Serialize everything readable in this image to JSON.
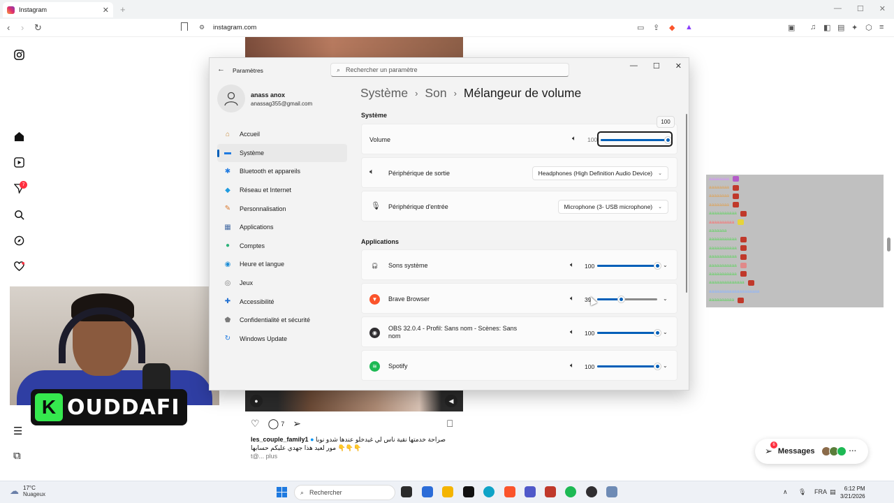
{
  "browser": {
    "tab_title": "Instagram",
    "tab_close": "✕",
    "new_tab": "+",
    "url": "instagram.com",
    "controls": {
      "minimize": "—",
      "maximize": "☐",
      "close": "✕"
    }
  },
  "instagram": {
    "nav_badge": "7",
    "post": {
      "comment_count": "7",
      "username": "les_couple_family1",
      "caption_line1": "صراحة خدمتها نقية ناس لي غيدخلو عندها شدو نوبا",
      "caption_line2": "مور لعيد هذا جهدي عليكم حسابها 👇👇👇",
      "tag": "t@...",
      "more": "plus"
    },
    "messages": {
      "label": "Messages",
      "badge": "6"
    }
  },
  "stream": {
    "badge_letter": "K",
    "badge_name": "OUDDAFI",
    "chat_rows": [
      {
        "user": "aaaaaaaa",
        "color": "#d38cff",
        "emote": "#b45cc9"
      },
      {
        "user": "aaaaaaaa",
        "color": "#e0a050",
        "emote": "#c0392b"
      },
      {
        "user": "aaaaaaaa",
        "color": "#e0a050",
        "emote": "#c0392b"
      },
      {
        "user": "aaaaaaaa",
        "color": "#e0a050",
        "emote": "#c0392b"
      },
      {
        "user": "aaaaaaaaaaa",
        "color": "#5fd35f",
        "emote": "#c0392b"
      },
      {
        "user": "aaaaaaaaaa",
        "color": "#ff6b6b",
        "emote": "#e6d43a"
      },
      {
        "user": "aaaaaaa",
        "color": "#5fd35f",
        "emote": ""
      },
      {
        "user": "aaaaaaaaaaa",
        "color": "#5fd35f",
        "emote": "#c0392b"
      },
      {
        "user": "aaaaaaaaaaa",
        "color": "#5fd35f",
        "emote": "#c0392b"
      },
      {
        "user": "aaaaaaaaaaa",
        "color": "#5fd35f",
        "emote": "#c0392b"
      },
      {
        "user": "aaaaaaaaaaa",
        "color": "#5fd35f",
        "emote": "#e08a8a"
      },
      {
        "user": "aaaaaaaaaaa",
        "color": "#5fd35f",
        "emote": "#c0392b"
      },
      {
        "user": "aaaaaaaaaaaaaa",
        "color": "#5fd35f",
        "emote": "#c0392b"
      },
      {
        "user": "aaaaaaaaaaaaaaaaaaaa",
        "color": "#8ab4ff",
        "emote": ""
      },
      {
        "user": "aaaaaaaaaa",
        "color": "#5fd35f",
        "emote": "#c0392b"
      }
    ]
  },
  "settings": {
    "title": "Paramètres",
    "search_placeholder": "Rechercher un paramètre",
    "user_name": "anass anox",
    "user_email": "anassag355@gmail.com",
    "nav": [
      {
        "label": "Accueil",
        "icon": "home-icon",
        "color": "#c98a3a"
      },
      {
        "label": "Système",
        "icon": "system-icon",
        "color": "#1f7ae0",
        "active": true
      },
      {
        "label": "Bluetooth et appareils",
        "icon": "bluetooth-icon",
        "color": "#1f7ae0"
      },
      {
        "label": "Réseau et Internet",
        "icon": "network-icon",
        "color": "#1f9be0"
      },
      {
        "label": "Personnalisation",
        "icon": "brush-icon",
        "color": "#d9772b"
      },
      {
        "label": "Applications",
        "icon": "apps-icon",
        "color": "#4a6fa5"
      },
      {
        "label": "Comptes",
        "icon": "account-icon",
        "color": "#2db37a"
      },
      {
        "label": "Heure et langue",
        "icon": "globe-icon",
        "color": "#1f8ed6"
      },
      {
        "label": "Jeux",
        "icon": "gamepad-icon",
        "color": "#777777"
      },
      {
        "label": "Accessibilité",
        "icon": "accessibility-icon",
        "color": "#1f6fd1"
      },
      {
        "label": "Confidentialité et sécurité",
        "icon": "shield-icon",
        "color": "#7a7a7a"
      },
      {
        "label": "Windows Update",
        "icon": "update-icon",
        "color": "#1f7ae0"
      }
    ],
    "breadcrumb": {
      "level1": "Système",
      "level2": "Son",
      "current": "Mélangeur de volume",
      "separator": "›"
    },
    "system_section": "Système",
    "volume": {
      "label": "Volume",
      "value": "100",
      "level": 100,
      "tooltip": "100"
    },
    "output": {
      "label": "Périphérique de sortie",
      "value": "Headphones (High Definition Audio Device)"
    },
    "input": {
      "label": "Périphérique d'entrée",
      "value": "Microphone (3- USB microphone)"
    },
    "apps_section": "Applications",
    "apps": [
      {
        "name": "Sons système",
        "value": "100",
        "level": 100,
        "icon": "headphones-icon"
      },
      {
        "name": "Brave Browser",
        "value": "39",
        "level": 39,
        "icon": "brave-icon"
      },
      {
        "name": "OBS 32.0.4 - Profil: Sans nom - Scènes: Sans nom",
        "value": "100",
        "level": 100,
        "icon": "obs-icon"
      },
      {
        "name": "Spotify",
        "value": "100",
        "level": 100,
        "icon": "spotify-icon"
      }
    ]
  },
  "taskbar": {
    "temperature": "17°C",
    "weather": "Nuageux",
    "search": "Rechercher",
    "language": "FRA",
    "time": "6:12 PM",
    "date": "3/21/2026"
  }
}
